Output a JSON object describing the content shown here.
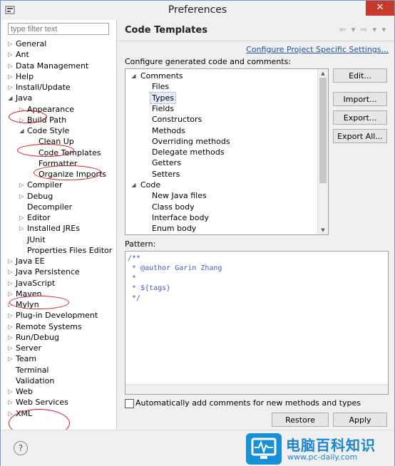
{
  "window": {
    "title": "Preferences",
    "close_glyph": "✕"
  },
  "filter": {
    "placeholder": "type filter text"
  },
  "tree": [
    {
      "label": "General",
      "level": 0,
      "expander": "collapsed"
    },
    {
      "label": "Ant",
      "level": 0,
      "expander": "collapsed"
    },
    {
      "label": "Data Management",
      "level": 0,
      "expander": "collapsed"
    },
    {
      "label": "Help",
      "level": 0,
      "expander": "collapsed"
    },
    {
      "label": "Install/Update",
      "level": 0,
      "expander": "collapsed"
    },
    {
      "label": "Java",
      "level": 0,
      "expander": "expanded"
    },
    {
      "label": "Appearance",
      "level": 1,
      "expander": "collapsed"
    },
    {
      "label": "Build Path",
      "level": 1,
      "expander": "collapsed"
    },
    {
      "label": "Code Style",
      "level": 1,
      "expander": "expanded"
    },
    {
      "label": "Clean Up",
      "level": 2,
      "expander": "none"
    },
    {
      "label": "Code Templates",
      "level": 2,
      "expander": "none",
      "selected": true
    },
    {
      "label": "Formatter",
      "level": 2,
      "expander": "none"
    },
    {
      "label": "Organize Imports",
      "level": 2,
      "expander": "none"
    },
    {
      "label": "Compiler",
      "level": 1,
      "expander": "collapsed"
    },
    {
      "label": "Debug",
      "level": 1,
      "expander": "collapsed"
    },
    {
      "label": "Decompiler",
      "level": 1,
      "expander": "none"
    },
    {
      "label": "Editor",
      "level": 1,
      "expander": "collapsed"
    },
    {
      "label": "Installed JREs",
      "level": 1,
      "expander": "collapsed"
    },
    {
      "label": "JUnit",
      "level": 1,
      "expander": "none"
    },
    {
      "label": "Properties Files Editor",
      "level": 1,
      "expander": "none"
    },
    {
      "label": "Java EE",
      "level": 0,
      "expander": "collapsed"
    },
    {
      "label": "Java Persistence",
      "level": 0,
      "expander": "collapsed"
    },
    {
      "label": "JavaScript",
      "level": 0,
      "expander": "collapsed"
    },
    {
      "label": "Maven",
      "level": 0,
      "expander": "collapsed"
    },
    {
      "label": "Mylyn",
      "level": 0,
      "expander": "collapsed"
    },
    {
      "label": "Plug-in Development",
      "level": 0,
      "expander": "collapsed"
    },
    {
      "label": "Remote Systems",
      "level": 0,
      "expander": "collapsed"
    },
    {
      "label": "Run/Debug",
      "level": 0,
      "expander": "collapsed"
    },
    {
      "label": "Server",
      "level": 0,
      "expander": "collapsed"
    },
    {
      "label": "Team",
      "level": 0,
      "expander": "collapsed"
    },
    {
      "label": "Terminal",
      "level": 0,
      "expander": "none"
    },
    {
      "label": "Validation",
      "level": 0,
      "expander": "none"
    },
    {
      "label": "Web",
      "level": 0,
      "expander": "collapsed"
    },
    {
      "label": "Web Services",
      "level": 0,
      "expander": "collapsed"
    },
    {
      "label": "XML",
      "level": 0,
      "expander": "collapsed"
    }
  ],
  "page": {
    "title": "Code Templates",
    "nav_icons": "⇦ ▾ ⇨ ▾ ▾",
    "link": "Configure Project Specific Settings...",
    "configure_label": "Configure generated code and comments:",
    "templates": [
      {
        "label": "Comments",
        "level": 0,
        "expander": "expanded"
      },
      {
        "label": "Files",
        "level": 1
      },
      {
        "label": "Types",
        "level": 1,
        "selected": true
      },
      {
        "label": "Fields",
        "level": 1
      },
      {
        "label": "Constructors",
        "level": 1
      },
      {
        "label": "Methods",
        "level": 1
      },
      {
        "label": "Overriding methods",
        "level": 1
      },
      {
        "label": "Delegate methods",
        "level": 1
      },
      {
        "label": "Getters",
        "level": 1
      },
      {
        "label": "Setters",
        "level": 1
      },
      {
        "label": "Code",
        "level": 0,
        "expander": "expanded"
      },
      {
        "label": "New Java files",
        "level": 1
      },
      {
        "label": "Class body",
        "level": 1
      },
      {
        "label": "Interface body",
        "level": 1
      },
      {
        "label": "Enum body",
        "level": 1
      }
    ],
    "buttons": {
      "edit": "Edit...",
      "import": "Import...",
      "export": "Export...",
      "export_all": "Export All..."
    },
    "pattern_label": "Pattern:",
    "pattern_lines": [
      "/**",
      " * @author Garin Zhang",
      " *",
      " * ${tags}",
      " */"
    ],
    "auto_comments_label": "Automatically add comments for new methods and types",
    "auto_comments_checked": false,
    "restore_defaults": "Restore Defaults",
    "apply": "Apply"
  },
  "footer": {
    "help_glyph": "?"
  },
  "watermark": {
    "text": "电脑百科知识",
    "url": "www.pc-daily.com"
  },
  "annotation_color": "#d7182a"
}
